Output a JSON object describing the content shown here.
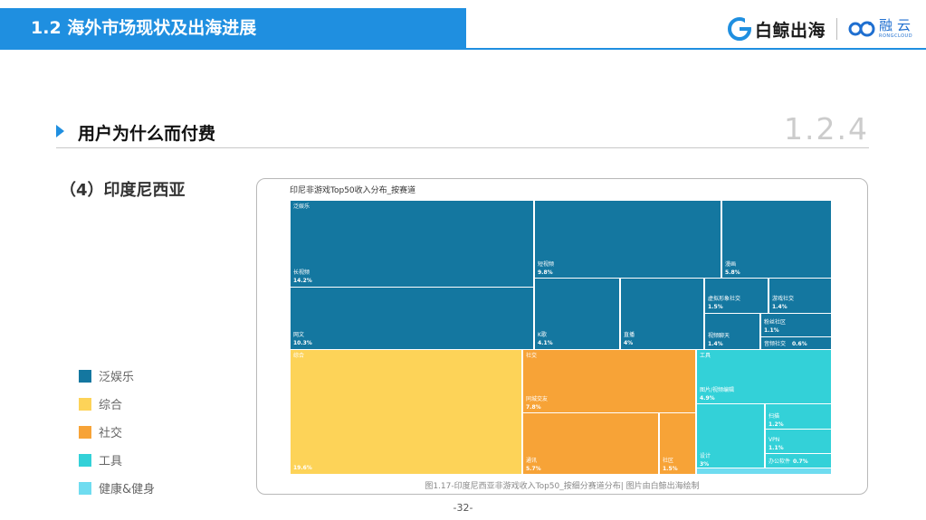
{
  "header": {
    "title": "1.2 海外市场现状及出海进展"
  },
  "brand": {
    "baijing": "白鲸出海",
    "rongyun": "融云",
    "rongyun_en": "RONGCLOUD"
  },
  "section": {
    "label": "用户为什么而付费",
    "number": "1.2.4"
  },
  "subtitle": "（4）印度尼西亚",
  "legend": [
    {
      "label": "泛娱乐",
      "color": "#1477a0"
    },
    {
      "label": "综合",
      "color": "#fdd358"
    },
    {
      "label": "社交",
      "color": "#f7a337"
    },
    {
      "label": "工具",
      "color": "#33d1d8"
    },
    {
      "label": "健康&健身",
      "color": "#6fdcf0"
    }
  ],
  "chart_data": {
    "type": "treemap",
    "title": "印尼非游戏Top50收入分布_按赛道",
    "groups": [
      "泛娱乐",
      "综合",
      "社交",
      "工具"
    ],
    "items": [
      {
        "group": "泛娱乐",
        "label": "长视频",
        "value": "14.2%"
      },
      {
        "group": "泛娱乐",
        "label": "网文",
        "value": "10.3%"
      },
      {
        "group": "泛娱乐",
        "label": "短视频",
        "value": "9.8%"
      },
      {
        "group": "泛娱乐",
        "label": "漫画",
        "value": "5.8%"
      },
      {
        "group": "泛娱乐",
        "label": "K歌",
        "value": "4.1%"
      },
      {
        "group": "泛娱乐",
        "label": "直播",
        "value": "4%"
      },
      {
        "group": "泛娱乐",
        "label": "虚拟形象社交",
        "value": "1.5%"
      },
      {
        "group": "泛娱乐",
        "label": "游戏社交",
        "value": "1.4%"
      },
      {
        "group": "泛娱乐",
        "label": "粉丝社区",
        "value": "1.1%"
      },
      {
        "group": "泛娱乐",
        "label": "视频聊天",
        "value": "1.4%"
      },
      {
        "group": "泛娱乐",
        "label": "音频社交",
        "value": "0.6%"
      },
      {
        "group": "综合",
        "label": "",
        "value": "19.6%"
      },
      {
        "group": "社交",
        "label": "同城交友",
        "value": "7.8%"
      },
      {
        "group": "社交",
        "label": "通讯",
        "value": "5.7%"
      },
      {
        "group": "社交",
        "label": "社区",
        "value": "1.5%"
      },
      {
        "group": "工具",
        "label": "图片/视频编辑",
        "value": "4.9%"
      },
      {
        "group": "工具",
        "label": "设计",
        "value": "3%"
      },
      {
        "group": "工具",
        "label": "扫描",
        "value": "1.2%"
      },
      {
        "group": "工具",
        "label": "VPN",
        "value": "1.1%"
      },
      {
        "group": "工具",
        "label": "办公软件",
        "value": "0.7%"
      }
    ]
  },
  "caption": "图1.17-印度尼西亚非游戏收入Top50_按细分赛道分布| 图片由白鲸出海绘制",
  "page_number": "-32-"
}
